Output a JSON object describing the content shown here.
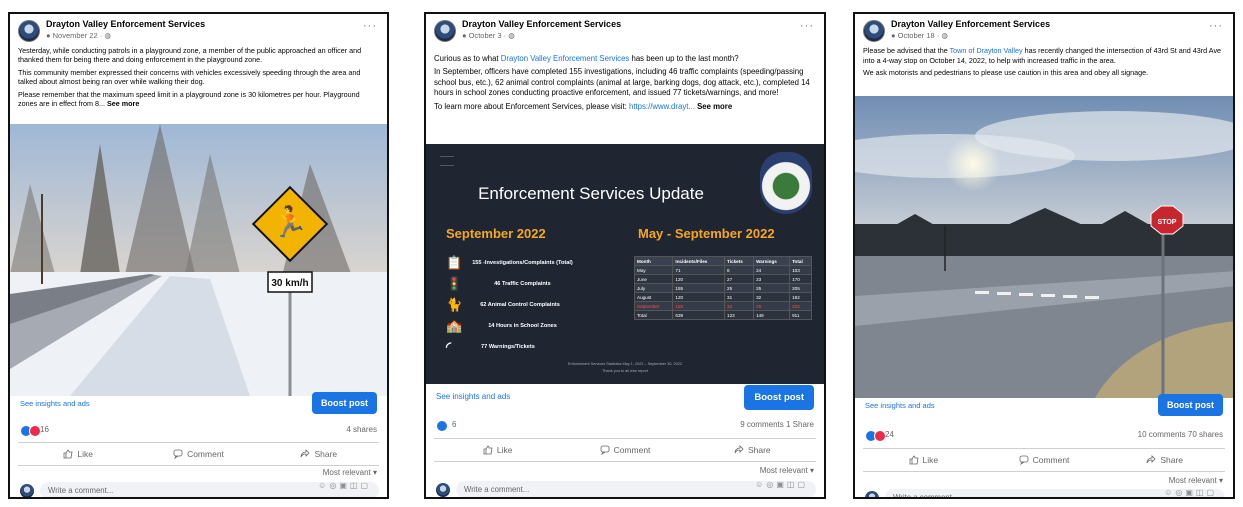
{
  "posts": [
    {
      "page_name": "Drayton Valley Enforcement Services",
      "date": "November 22 ·",
      "paragraphs": [
        "Yesterday, while conducting patrols in a playground zone, a member of the public approached an officer and thanked them for being there and doing enforcement in the playground zone.",
        "This community member expressed their concerns with vehicles excessively speeding through the area and talked about almost being ran over while walking their dog.",
        "Please remember that the maximum speed limit in a playground zone is 30 kilometres per hour. Playground zones are in effect from 8..."
      ],
      "see_more": "See more",
      "sign_text": "30 km/h",
      "insights": "See insights and ads",
      "boost": "Boost post",
      "reaction_count": "16",
      "stats": "4 shares",
      "actions": [
        "Like",
        "Comment",
        "Share"
      ],
      "relevance": "Most relevant ▾",
      "comment_placeholder": "Write a comment..."
    },
    {
      "page_name": "Drayton Valley Enforcement Services",
      "date": "October 3 ·",
      "para1_a": "Curious as to what ",
      "para1_link": "Drayton Valley Enforcement Services",
      "para1_b": " has been up to the last month?",
      "para2": "In September, officers have completed 155 investigations, including 46 traffic complaints (speeding/passing school bus, etc.), 62 animal control complaints (animal at large, barking dogs, dog attack, etc.), completed 14 hours in school zones conducting proactive enforcement, and issued 77 tickets/warnings, and more!",
      "para3_a": "To learn more about Enforcement Services, please visit: ",
      "para3_link": "https://www.drayt...",
      "see_more": "See more",
      "graphic": {
        "title": "Enforcement Services Update",
        "left_heading": "September 2022",
        "right_heading": "May - September 2022",
        "stats": [
          "155 -Investigations/Complaints (Total)",
          "46 Traffic Complaints",
          "62 Animal Control Complaints",
          "14 Hours in School Zones",
          "77 Warnings/Tickets"
        ],
        "table_headers": [
          "Month",
          "Incidents/Files",
          "Tickets",
          "Warnings",
          "Total"
        ],
        "table_rows": [
          [
            "May",
            "71",
            "8",
            "24",
            "103"
          ],
          [
            "June",
            "120",
            "27",
            "23",
            "170"
          ],
          [
            "July",
            "155",
            "25",
            "25",
            "205"
          ],
          [
            "August",
            "120",
            "31",
            "32",
            "182"
          ],
          [
            "September",
            "155",
            "32",
            "45",
            "232"
          ],
          [
            "Total",
            "639",
            "123",
            "149",
            "911"
          ]
        ],
        "footnote": "Enforcement Services Statistics May 1, 2022 – September 30, 2022",
        "footnote2": "Thank you to all who report"
      },
      "insights": "See insights and ads",
      "boost": "Boost post",
      "reaction_count": "6",
      "stats": "9 comments  1 Share",
      "actions": [
        "Like",
        "Comment",
        "Share"
      ],
      "relevance": "Most relevant ▾",
      "comment_placeholder": "Write a comment..."
    },
    {
      "page_name": "Drayton Valley Enforcement Services",
      "date": "October 18 ·",
      "para1_a": "Please be advised that the ",
      "para1_link": "Town of Drayton Valley",
      "para1_b": " has recently changed the intersection of 43rd St and 43rd Ave into a 4-way stop on October 14, 2022, to help with increased traffic in the area.",
      "para2": "We ask motorists and pedestrians to please use caution in this area and obey all signage.",
      "sign_text": "STOP",
      "insights": "See insights and ads",
      "boost": "Boost post",
      "reaction_count": "24",
      "stats": "10 comments  70 shares",
      "actions": [
        "Like",
        "Comment",
        "Share"
      ],
      "relevance": "Most relevant ▾",
      "comment_placeholder": "Write a comment..."
    }
  ]
}
